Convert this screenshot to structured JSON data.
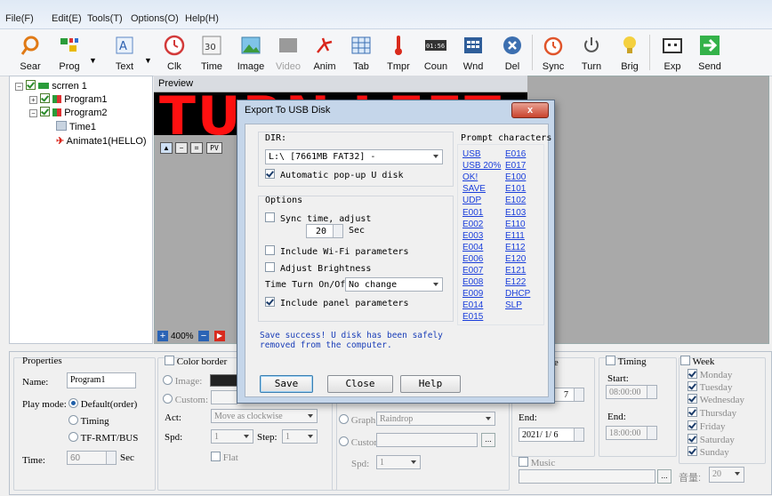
{
  "menu": [
    "File(F)",
    "Edit(E)",
    "Tools(T)",
    "Options(O)",
    "Help(H)"
  ],
  "toolbar": [
    {
      "label": "Sear",
      "icon": "search-icon"
    },
    {
      "label": "Prog",
      "icon": "program-icon"
    },
    {
      "label": "Text",
      "icon": "text-icon"
    },
    {
      "label": "Clk",
      "icon": "clock-icon"
    },
    {
      "label": "Time",
      "icon": "calendar-icon",
      "icon_text": "30"
    },
    {
      "label": "Image",
      "icon": "image-icon"
    },
    {
      "label": "Video",
      "icon": "video-icon",
      "disabled": true
    },
    {
      "label": "Anim",
      "icon": "animation-icon"
    },
    {
      "label": "Tab",
      "icon": "table-icon"
    },
    {
      "label": "Tmpr",
      "icon": "thermometer-icon"
    },
    {
      "label": "Coun",
      "icon": "counter-icon",
      "icon_text": "01:56"
    },
    {
      "label": "Wnd",
      "icon": "window-icon"
    },
    {
      "label": "Del",
      "icon": "delete-icon"
    },
    {
      "label": "Sync",
      "icon": "alarm-clock-icon"
    },
    {
      "label": "Turn",
      "icon": "power-icon"
    },
    {
      "label": "Brig",
      "icon": "bulb-icon"
    },
    {
      "label": "Exp",
      "icon": "export-icon"
    },
    {
      "label": "Send",
      "icon": "send-arrow-icon"
    }
  ],
  "tree": {
    "screen": "scrren 1",
    "program1": "Program1",
    "program2": "Program2",
    "time1": "Time1",
    "animate1": "Animate1(HELLO)"
  },
  "preview": {
    "header": "Preview",
    "led_text": "TURN LEFT",
    "pv": "PV",
    "zoom": "400%"
  },
  "dialog": {
    "title": "Export To USB Disk",
    "close": "x",
    "dir_label": "DIR:",
    "dir_value": "L:\\ [7661MB FAT32] -",
    "auto_popup": "Automatic pop-up U disk",
    "options_label": "Options",
    "sync_time": "Sync time, adjust",
    "sync_value": "20",
    "sec": "Sec",
    "wifi": "Include Wi-Fi parameters",
    "brightness": "Adjust Brightness",
    "time_turn_label": "Time Turn On/Off",
    "time_turn_value": "No change",
    "panel_params": "Include panel parameters",
    "prompt_label": "Prompt characters",
    "prompt_col1": [
      "USB",
      "USB 20%",
      "OK!",
      "SAVE",
      "UDP",
      "E001",
      "E002",
      "E003",
      "E004",
      "E006",
      "E007",
      "E008",
      "E009",
      "E014",
      "E015"
    ],
    "prompt_col2": [
      "E016",
      "E017",
      "E100",
      "E101",
      "E102",
      "E103",
      "E110",
      "E111",
      "E112",
      "E120",
      "E121",
      "E122",
      "DHCP",
      "SLP"
    ],
    "status": "Save success! U disk has been safely removed from the computer.",
    "save": "Save",
    "close_btn": "Close",
    "help": "Help"
  },
  "properties": {
    "title": "Properties",
    "name_label": "Name:",
    "name_value": "Program1",
    "play_mode_label": "Play mode:",
    "mode_default": "Default(order)",
    "mode_timing": "Timing",
    "mode_tf": "TF-RMT/BUS",
    "time_label": "Time:",
    "time_value": "60",
    "time_unit": "Sec",
    "color_border": "Color border",
    "image_label": "Image:",
    "custom_label": "Custom:",
    "act_label": "Act:",
    "act_value": "Move as clockwise",
    "spd_label": "Spd:",
    "spd_value": "1",
    "step_label": "Step:",
    "step_value": "1",
    "flat": "Flat",
    "graph_label": "Graph",
    "graph_value": "Raindrop",
    "custom2_label": "Custom",
    "spd2_label": "Spd:",
    "spd2_value": "1",
    "range_label": "ange",
    "start_date_partial": "7",
    "end_label": "End:",
    "end_date": "2021/ 1/ 6",
    "timing_label": "Timing",
    "start_label": "Start:",
    "start_time": "08:00:00",
    "end2_label": "End:",
    "end_time": "18:00:00",
    "week_label": "Week",
    "days": [
      "Monday",
      "Tuesday",
      "Wednesday",
      "Thursday",
      "Friday",
      "Saturday",
      "Sunday"
    ],
    "music_label": "Music",
    "volume_label": "音量:",
    "volume_value": "20"
  }
}
